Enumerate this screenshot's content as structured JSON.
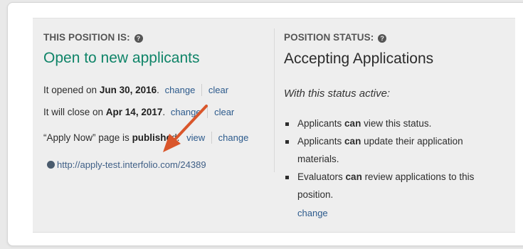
{
  "position": {
    "heading": "THIS POSITION IS:",
    "state": "Open to new applicants",
    "opened_prefix": "It opened on ",
    "opened_date": "Jun 30, 2016",
    "opened_suffix": ".",
    "close_prefix": "It will close on ",
    "close_date": "Apr 14, 2017",
    "close_suffix": ".",
    "apply_prefix": "“Apply Now” page is ",
    "apply_status": "publishe",
    "apply_suffix": "d.",
    "link_change": "change",
    "link_clear": "clear",
    "link_view": "view",
    "url": "http://apply-test.interfolio.com/24389"
  },
  "status": {
    "heading": "POSITION STATUS:",
    "value": "Accepting Applications",
    "intro": "With this status active:",
    "bullets": [
      {
        "pre": "Applicants ",
        "bold": "can",
        "post": " view this status."
      },
      {
        "pre": "Applicants ",
        "bold": "can",
        "post": " update their application"
      },
      {
        "cont": "materials."
      },
      {
        "pre": "Evaluators ",
        "bold": "can",
        "post": " review applications to this"
      },
      {
        "cont": "position."
      }
    ],
    "change": "change"
  },
  "help_icon": "question-circle-icon",
  "colors": {
    "accent_green": "#0f8468",
    "link_blue": "#2c5a8c",
    "arrow": "#d9562b"
  }
}
